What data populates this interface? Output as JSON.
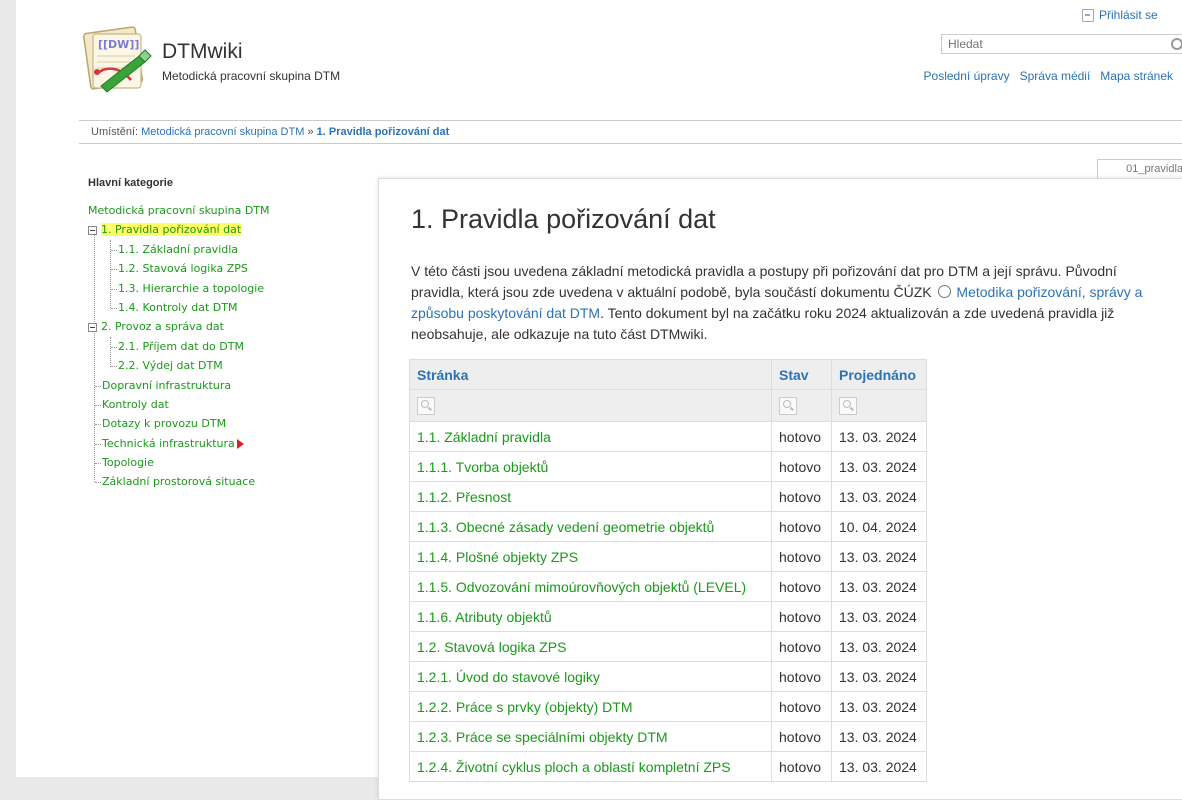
{
  "header": {
    "site_title": "DTMwiki",
    "site_tagline": "Metodická pracovní skupina DTM",
    "login_label": "Přihlásit se",
    "search_placeholder": "Hledat",
    "tools": [
      "Poslední úpravy",
      "Správa médií",
      "Mapa stránek"
    ]
  },
  "breadcrumb": {
    "prefix": "Umístění:",
    "parent": "Metodická pracovní skupina DTM",
    "separator": "»",
    "current": "1. Pravidla pořizování dat"
  },
  "sidebar": {
    "title": "Hlavní kategorie",
    "items": [
      {
        "label": "Metodická pracovní skupina DTM",
        "level": 0
      },
      {
        "label": "1. Pravidla pořizování dat",
        "level": 0,
        "toggle": "minus",
        "active": true
      },
      {
        "label": "1.1. Základní pravidla",
        "level": 1
      },
      {
        "label": "1.2. Stavová logika ZPS",
        "level": 1
      },
      {
        "label": "1.3. Hierarchie a topologie",
        "level": 1
      },
      {
        "label": "1.4. Kontroly dat DTM",
        "level": 1
      },
      {
        "label": "2. Provoz a správa dat",
        "level": 0,
        "toggle": "minus"
      },
      {
        "label": "2.1. Příjem dat do DTM",
        "level": 1
      },
      {
        "label": "2.2. Výdej dat DTM",
        "level": 1
      },
      {
        "label": "Dopravní infrastruktura",
        "level": 0
      },
      {
        "label": "Kontroly dat",
        "level": 0
      },
      {
        "label": "Dotazy k provozu DTM",
        "level": 0
      },
      {
        "label": "Technická infrastruktura",
        "level": 0,
        "arrow": true
      },
      {
        "label": "Topologie",
        "level": 0
      },
      {
        "label": "Základní prostorová situace",
        "level": 0
      }
    ]
  },
  "content": {
    "page_id": "01_pravidla",
    "title": "1. Pravidla pořizování dat",
    "intro_1": "V této části jsou uvedena základní metodická pravidla a postupy při pořizování dat pro DTM a její správu. Původní pravidla, která jsou zde uvedena v aktuální podobě, byla součástí dokumentu ČÚZK",
    "intro_link": "Metodika pořizování, správy a způsobu poskytování dat DTM",
    "intro_2": ". Tento dokument byl na začátku roku 2024 aktualizován a zde uvedená pravidla již neobsahuje, ale odkazuje na tuto část DTMwiki.",
    "table": {
      "headers": [
        "Stránka",
        "Stav",
        "Projednáno"
      ],
      "rows": [
        [
          "1.1. Základní pravidla",
          "hotovo",
          "13. 03. 2024"
        ],
        [
          "1.1.1. Tvorba objektů",
          "hotovo",
          "13. 03. 2024"
        ],
        [
          "1.1.2. Přesnost",
          "hotovo",
          "13. 03. 2024"
        ],
        [
          "1.1.3. Obecné zásady vedení geometrie objektů",
          "hotovo",
          "10. 04. 2024"
        ],
        [
          "1.1.4. Plošné objekty ZPS",
          "hotovo",
          "13. 03. 2024"
        ],
        [
          "1.1.5. Odvozování mimoúrovňových objektů (LEVEL)",
          "hotovo",
          "13. 03. 2024"
        ],
        [
          "1.1.6. Atributy objektů",
          "hotovo",
          "13. 03. 2024"
        ],
        [
          "1.2. Stavová logika ZPS",
          "hotovo",
          "13. 03. 2024"
        ],
        [
          "1.2.1. Úvod do stavové logiky",
          "hotovo",
          "13. 03. 2024"
        ],
        [
          "1.2.2. Práce s prvky (objekty) DTM",
          "hotovo",
          "13. 03. 2024"
        ],
        [
          "1.2.3. Práce se speciálními objekty DTM",
          "hotovo",
          "13. 03. 2024"
        ],
        [
          "1.2.4. Životní cyklus ploch a oblastí kompletní ZPS",
          "hotovo",
          "13. 03. 2024"
        ]
      ]
    }
  }
}
